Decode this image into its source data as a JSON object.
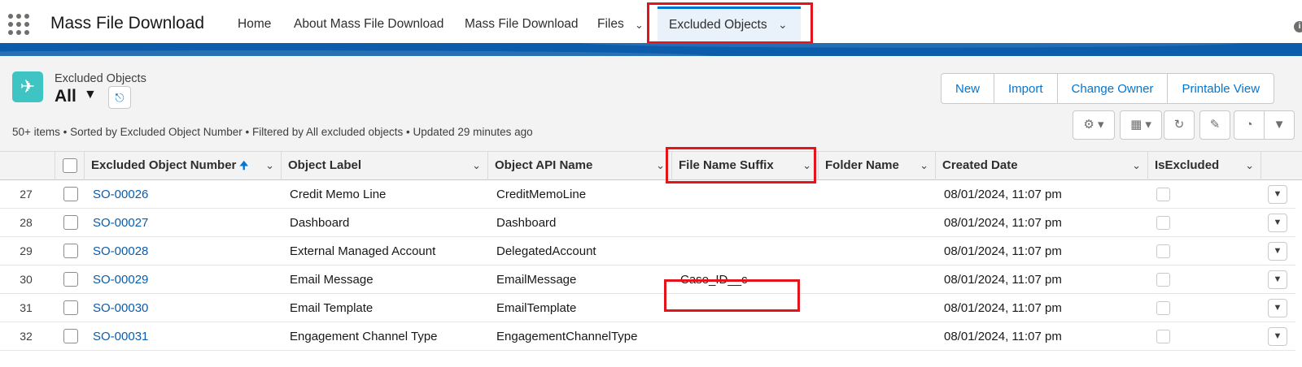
{
  "app": {
    "name": "Mass File Download"
  },
  "nav": {
    "items": [
      "Home",
      "About Mass File Download",
      "Mass File Download",
      "Files"
    ],
    "active_tab": "Excluded Objects"
  },
  "list": {
    "object_type": "Excluded Objects",
    "view_name": "All",
    "summary": "50+ items • Sorted by Excluded Object Number • Filtered by All excluded objects • Updated 29 minutes ago",
    "buttons": [
      "New",
      "Import",
      "Change Owner",
      "Printable View"
    ]
  },
  "icons": {
    "app_launcher": "waffle-icon",
    "object": "plane-icon",
    "pin": "pin-icon",
    "settings": "gear-icon",
    "display": "table-view-icon",
    "refresh": "refresh-icon",
    "edit": "pencil-icon",
    "chart": "pie-chart-icon",
    "filter": "filter-icon"
  },
  "table": {
    "columns": [
      "Excluded Object Number",
      "Object Label",
      "Object API Name",
      "File Name Suffix",
      "Folder Name",
      "Created Date",
      "IsExcluded"
    ],
    "rows": [
      {
        "num": "27",
        "number": "SO-00026",
        "label": "Credit Memo Line",
        "api": "CreditMemoLine",
        "suffix": "",
        "folder": "",
        "date": "08/01/2024, 11:07 pm"
      },
      {
        "num": "28",
        "number": "SO-00027",
        "label": "Dashboard",
        "api": "Dashboard",
        "suffix": "",
        "folder": "",
        "date": "08/01/2024, 11:07 pm"
      },
      {
        "num": "29",
        "number": "SO-00028",
        "label": "External Managed Account",
        "api": "DelegatedAccount",
        "suffix": "",
        "folder": "",
        "date": "08/01/2024, 11:07 pm"
      },
      {
        "num": "30",
        "number": "SO-00029",
        "label": "Email Message",
        "api": "EmailMessage",
        "suffix": "Case_ID__c",
        "folder": "",
        "date": "08/01/2024, 11:07 pm"
      },
      {
        "num": "31",
        "number": "SO-00030",
        "label": "Email Template",
        "api": "EmailTemplate",
        "suffix": "",
        "folder": "",
        "date": "08/01/2024, 11:07 pm"
      },
      {
        "num": "32",
        "number": "SO-00031",
        "label": "Engagement Channel Type",
        "api": "EngagementChannelType",
        "suffix": "",
        "folder": "",
        "date": "08/01/2024, 11:07 pm"
      }
    ]
  },
  "colors": {
    "brand_blue": "#0176d3",
    "highlight_red": "#e4141b",
    "object_icon": "#3ec5c3",
    "band": "#0b5cab"
  }
}
